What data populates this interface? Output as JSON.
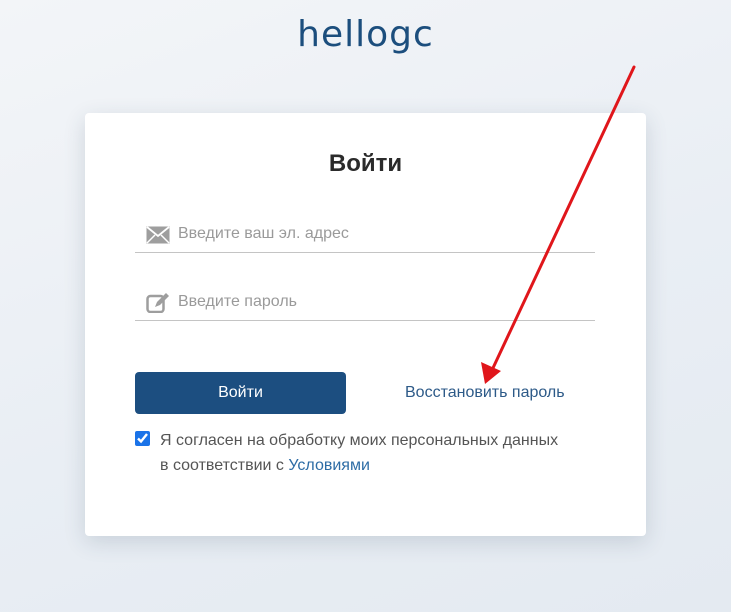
{
  "logo": {
    "text": "hellogc"
  },
  "login_form": {
    "title": "Войти",
    "email": {
      "placeholder": "Введите ваш эл. адрес",
      "value": "",
      "icon": "envelope-icon"
    },
    "password": {
      "placeholder": "Введите пароль",
      "value": "",
      "icon": "pencil-edit-icon"
    },
    "submit_label": "Войти",
    "restore_password_label": "Восстановить пароль",
    "consent": {
      "checked": true,
      "text_line1": "Я согласен на обработку моих персональных данных",
      "text_line2_prefix": "в соответствии с ",
      "link_label": "Условиями"
    }
  },
  "annotation": {
    "type": "red-arrow",
    "color": "#e0161b",
    "points_to": "restore-password-link"
  },
  "colors": {
    "brand": "#1c4e80",
    "link": "#2d5a88",
    "checkbox": "#1a73e8"
  }
}
